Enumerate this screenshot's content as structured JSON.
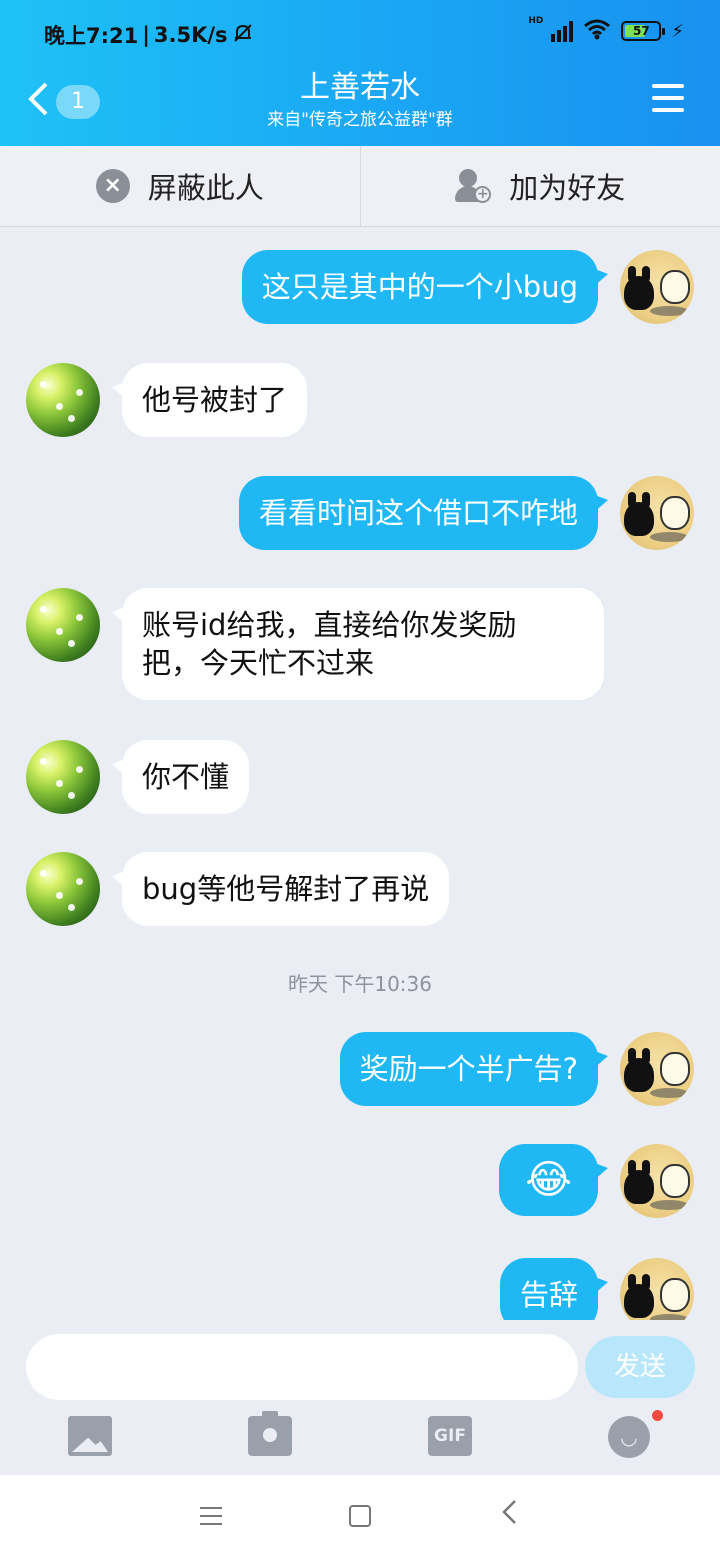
{
  "status_bar": {
    "time": "晚上7:21",
    "separator": "|",
    "net_speed": "3.5K/s",
    "mute_icon": "bell-off-icon",
    "signal_label": "HD",
    "battery": "57"
  },
  "header": {
    "unread_count": "1",
    "title": "上善若水",
    "subtitle": "来自\"传奇之旅公益群\"群"
  },
  "actions": {
    "block_label": "屏蔽此人",
    "add_friend_label": "加为好友"
  },
  "messages": [
    {
      "sender": "me",
      "text": "这只是其中的一个小bug"
    },
    {
      "sender": "them",
      "text": "他号被封了"
    },
    {
      "sender": "me",
      "text": "看看时间这个借口不咋地"
    },
    {
      "sender": "them",
      "text": "账号id给我，直接给你发奖励把，今天忙不过来"
    },
    {
      "sender": "them",
      "text": "你不懂"
    },
    {
      "sender": "them",
      "text": "bug等他号解封了再说"
    },
    {
      "sender": "timestamp",
      "text": "昨天 下午10:36"
    },
    {
      "sender": "me",
      "text": "奖励一个半广告?"
    },
    {
      "sender": "me",
      "text": "😂"
    },
    {
      "sender": "me",
      "text": "告辞"
    }
  ],
  "message_lines": {
    "m3_line1": "账号id给我，直接给你发奖励",
    "m3_line2": "把，今天忙不过来"
  },
  "input": {
    "placeholder": "",
    "send_label": "发送"
  },
  "toolbar": {
    "gif_label": "GIF",
    "icons": [
      "image-icon",
      "camera-icon",
      "gif-icon",
      "emoji-icon"
    ]
  },
  "colors": {
    "header": "#1aa6f4",
    "my_bubble": "#1fb8f5",
    "their_bubble": "#ffffff",
    "background": "#eaedf4"
  }
}
